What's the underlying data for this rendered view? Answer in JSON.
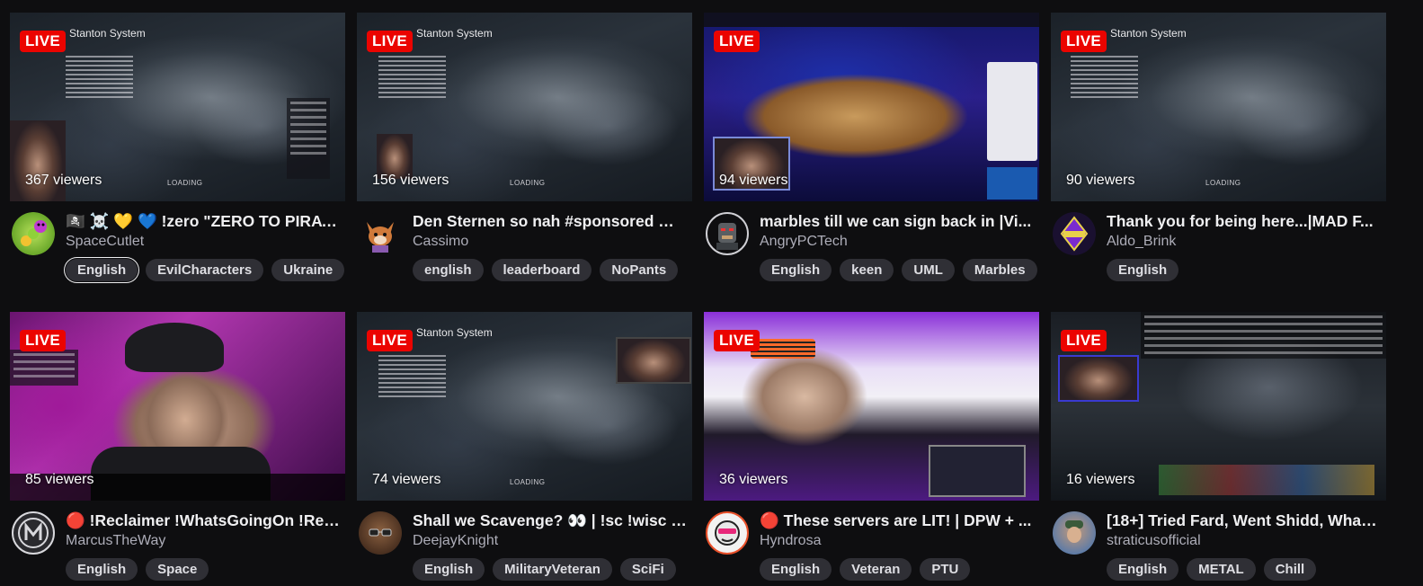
{
  "live_label": "LIVE",
  "loading_label": "LOADING",
  "thumb_overlay": {
    "system_title": "Stanton System"
  },
  "streams": [
    {
      "title": "🏴‍☠️ ☠️ 💛 💙 !zero \"ZERO TO PIRATE: ...",
      "channel": "SpaceCutlet",
      "viewers": "367 viewers",
      "tags": [
        "English",
        "EvilCharacters",
        "Ukraine"
      ],
      "avatar_icon": "caterpillar-icon",
      "avatar_color": "#8fd13a"
    },
    {
      "title": "Den Sternen so nah #sponsored ❗H...",
      "channel": "Cassimo",
      "viewers": "156 viewers",
      "tags": [
        "english",
        "leaderboard",
        "NoPants"
      ],
      "avatar_icon": "fox-icon",
      "avatar_color": "#a05a3a"
    },
    {
      "title": "marbles till we can sign back in |Vi...",
      "channel": "AngryPCTech",
      "viewers": "94 viewers",
      "tags": [
        "English",
        "keen",
        "UML",
        "Marbles"
      ],
      "avatar_icon": "robot-icon",
      "avatar_color": "#3c4a50"
    },
    {
      "title": "Thank you for being here...|MAD F...",
      "channel": "Aldo_Brink",
      "viewers": "90 viewers",
      "tags": [
        "English"
      ],
      "avatar_icon": "brand-logo-icon",
      "avatar_color": "#2a1a4a"
    },
    {
      "title": "🔴 !Reclaimer !WhatsGoingOn !Ref ...",
      "channel": "MarcusTheWay",
      "viewers": "85 viewers",
      "tags": [
        "English",
        "Space"
      ],
      "avatar_icon": "emblem-icon",
      "avatar_color": "#3a3a3e"
    },
    {
      "title": "Shall we Scavenge? 👀 | !sc !wisc !...",
      "channel": "DeejayKnight",
      "viewers": "74 viewers",
      "tags": [
        "English",
        "MilitaryVeteran",
        "SciFi"
      ],
      "avatar_icon": "face-glasses-icon",
      "avatar_color": "#6a4a30"
    },
    {
      "title": "🔴 These servers are LIT! | DPW + ...",
      "channel": "Hyndrosa",
      "viewers": "36 viewers",
      "tags": [
        "English",
        "Veteran",
        "PTU"
      ],
      "avatar_icon": "face-cartoon-icon",
      "avatar_color": "#e8e8e8"
    },
    {
      "title": "[18+] Tried Fard, Went Shidd, What ...",
      "channel": "straticusofficial",
      "viewers": "16 viewers",
      "tags": [
        "English",
        "METAL",
        "Chill"
      ],
      "avatar_icon": "face-photo-icon",
      "avatar_color": "#4a6a9a"
    }
  ]
}
